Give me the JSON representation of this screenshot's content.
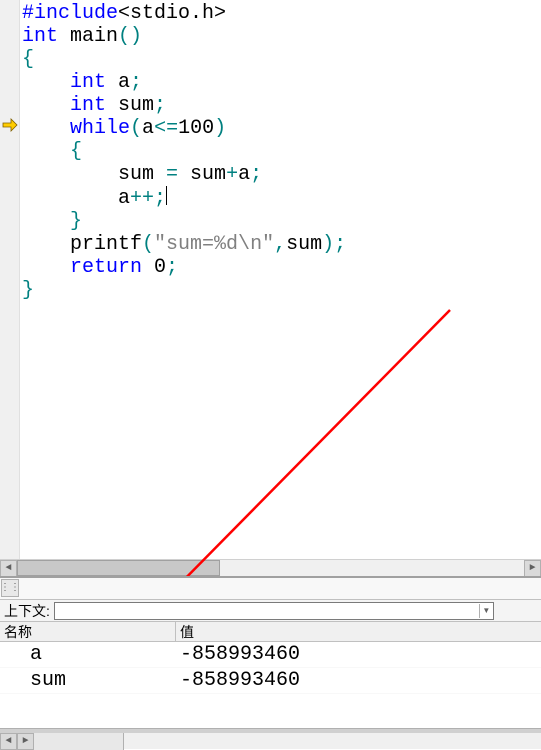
{
  "code": {
    "lines": [
      {
        "tokens": [
          {
            "t": "#include",
            "c": "kw-preproc"
          },
          {
            "t": "<"
          },
          {
            "t": "stdio.h",
            "c": "ident"
          },
          {
            "t": ">"
          }
        ]
      },
      {
        "tokens": [
          {
            "t": "int",
            "c": "kw-type"
          },
          {
            "t": " main",
            "c": "ident"
          },
          {
            "t": "()",
            "c": "punct"
          }
        ]
      },
      {
        "tokens": [
          {
            "t": "{",
            "c": "punct"
          }
        ]
      },
      {
        "tokens": [
          {
            "t": "    "
          },
          {
            "t": "int",
            "c": "kw-type"
          },
          {
            "t": " a",
            "c": "ident"
          },
          {
            "t": ";",
            "c": "punct"
          }
        ]
      },
      {
        "tokens": [
          {
            "t": "    "
          },
          {
            "t": "int",
            "c": "kw-type"
          },
          {
            "t": " sum",
            "c": "ident"
          },
          {
            "t": ";",
            "c": "punct"
          }
        ]
      },
      {
        "tokens": [
          {
            "t": "    "
          },
          {
            "t": "while",
            "c": "kw-keyword"
          },
          {
            "t": "(",
            "c": "punct"
          },
          {
            "t": "a",
            "c": "ident"
          },
          {
            "t": "<=",
            "c": "punct"
          },
          {
            "t": "100",
            "c": "num"
          },
          {
            "t": ")",
            "c": "punct"
          }
        ]
      },
      {
        "tokens": [
          {
            "t": "    "
          },
          {
            "t": "{",
            "c": "punct"
          }
        ]
      },
      {
        "tokens": [
          {
            "t": "        sum ",
            "c": "ident"
          },
          {
            "t": "=",
            "c": "punct"
          },
          {
            "t": " sum",
            "c": "ident"
          },
          {
            "t": "+",
            "c": "punct"
          },
          {
            "t": "a",
            "c": "ident"
          },
          {
            "t": ";",
            "c": "punct"
          }
        ]
      },
      {
        "tokens": [
          {
            "t": "        a",
            "c": "ident"
          },
          {
            "t": "++;",
            "c": "punct"
          }
        ],
        "caret": true
      },
      {
        "tokens": [
          {
            "t": "    "
          },
          {
            "t": "}",
            "c": "punct"
          }
        ]
      },
      {
        "tokens": [
          {
            "t": "    printf",
            "c": "ident"
          },
          {
            "t": "(",
            "c": "punct"
          },
          {
            "t": "\"sum=%d\\n\"",
            "c": "string"
          },
          {
            "t": ",",
            "c": "punct"
          },
          {
            "t": "sum",
            "c": "ident"
          },
          {
            "t": ")",
            "c": "punct"
          },
          {
            "t": ";",
            "c": "punct"
          }
        ]
      },
      {
        "tokens": [
          {
            "t": "    "
          },
          {
            "t": "return",
            "c": "kw-keyword"
          },
          {
            "t": " 0",
            "c": "num"
          },
          {
            "t": ";",
            "c": "punct"
          }
        ]
      },
      {
        "tokens": [
          {
            "t": "}",
            "c": "punct"
          }
        ]
      }
    ],
    "breakpoint_line": 5
  },
  "debug": {
    "context_label": "上下文:",
    "headers": {
      "name": "名称",
      "value": "值"
    },
    "variables": [
      {
        "name": "a",
        "value": "-858993460"
      },
      {
        "name": "sum",
        "value": "-858993460"
      }
    ]
  }
}
